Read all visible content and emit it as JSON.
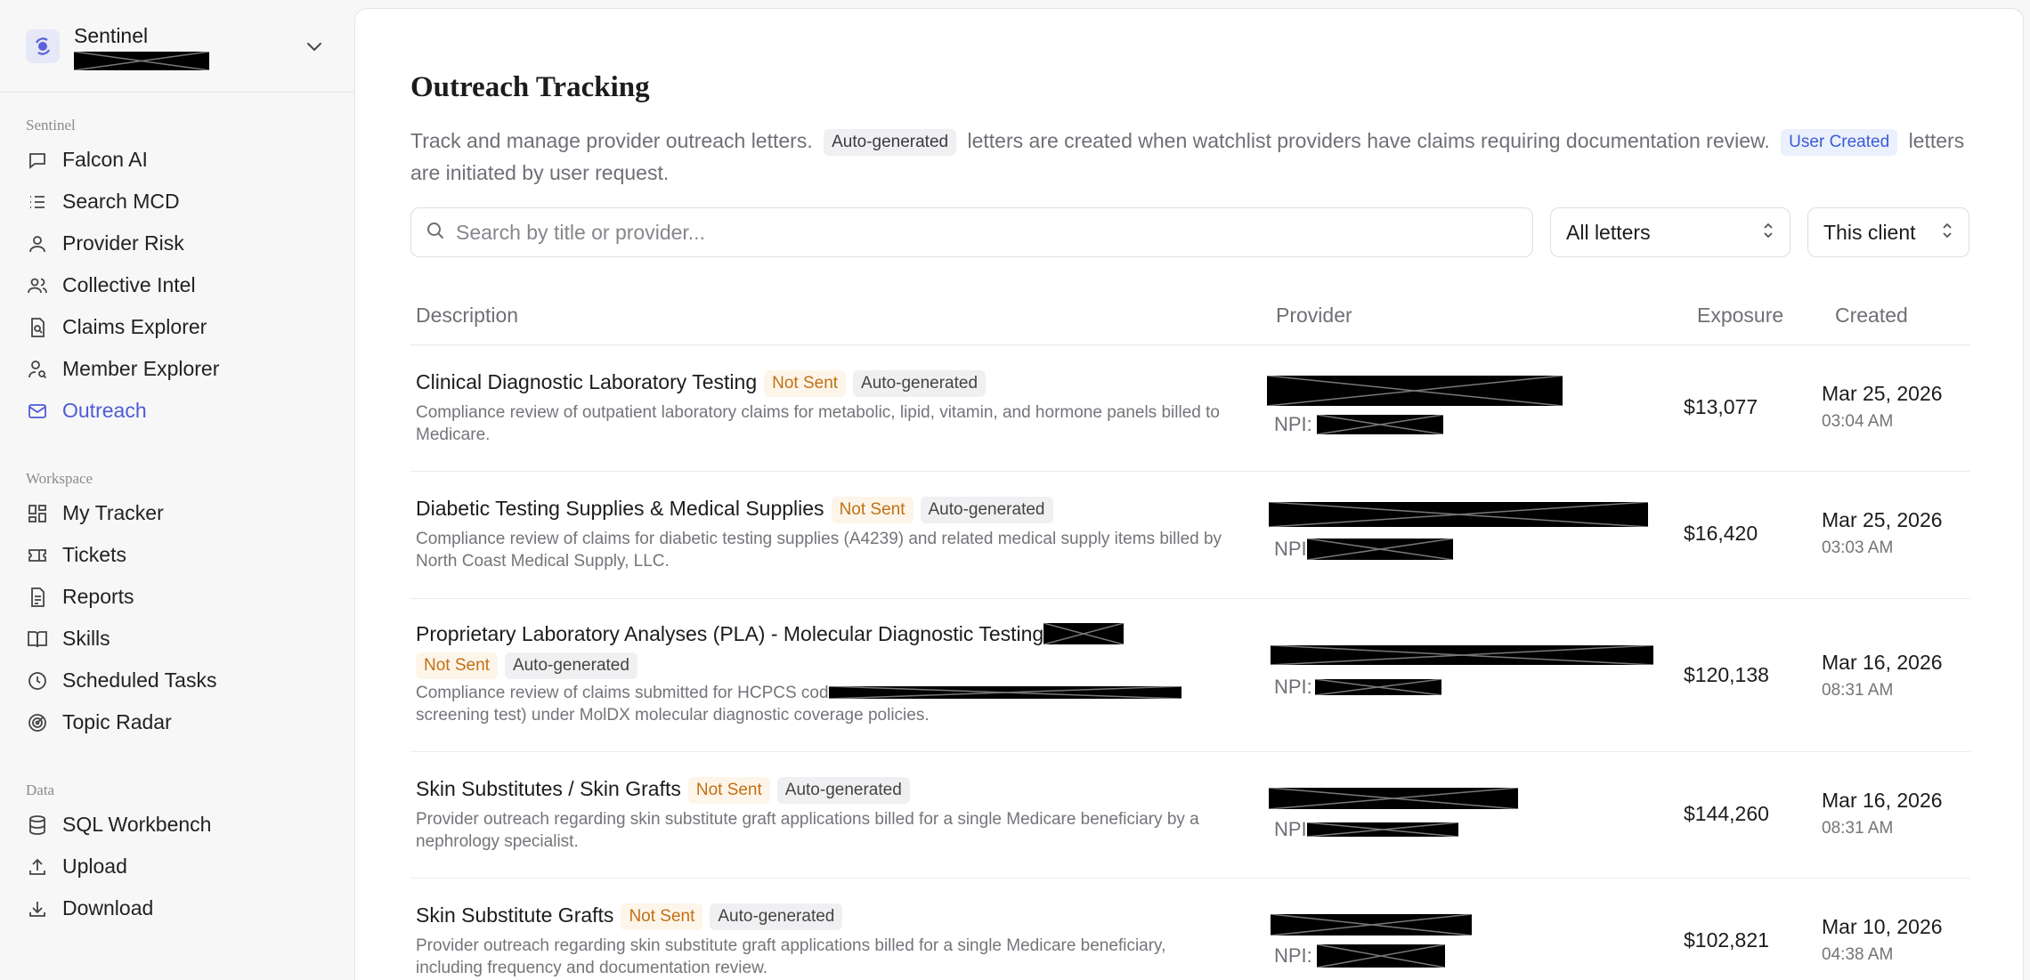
{
  "org": {
    "name": "Sentinel"
  },
  "nav": {
    "sections": [
      {
        "label": "Sentinel",
        "items": [
          {
            "label": "Falcon AI",
            "icon": "chat-icon"
          },
          {
            "label": "Search MCD",
            "icon": "list-icon"
          },
          {
            "label": "Provider Risk",
            "icon": "user-icon"
          },
          {
            "label": "Collective Intel",
            "icon": "users-icon"
          },
          {
            "label": "Claims Explorer",
            "icon": "document-search-icon"
          },
          {
            "label": "Member Explorer",
            "icon": "user-search-icon"
          },
          {
            "label": "Outreach",
            "icon": "mail-icon",
            "active": true
          }
        ]
      },
      {
        "label": "Workspace",
        "items": [
          {
            "label": "My Tracker",
            "icon": "dashboard-icon"
          },
          {
            "label": "Tickets",
            "icon": "ticket-icon"
          },
          {
            "label": "Reports",
            "icon": "report-icon"
          },
          {
            "label": "Skills",
            "icon": "book-icon"
          },
          {
            "label": "Scheduled Tasks",
            "icon": "clock-icon"
          },
          {
            "label": "Topic Radar",
            "icon": "radar-icon"
          }
        ]
      },
      {
        "label": "Data",
        "items": [
          {
            "label": "SQL Workbench",
            "icon": "database-icon"
          },
          {
            "label": "Upload",
            "icon": "upload-icon"
          },
          {
            "label": "Download",
            "icon": "download-icon"
          }
        ]
      }
    ]
  },
  "page": {
    "title": "Outreach Tracking",
    "intro_part1": "Track and manage provider outreach letters.",
    "chip_auto": "Auto-generated",
    "intro_part2": "letters are created when watchlist providers have claims requiring documentation review.",
    "chip_user": "User Created",
    "intro_part3": "letters are initiated by user request."
  },
  "filters": {
    "search_placeholder": "Search by title or provider...",
    "letters_value": "All letters",
    "scope_value": "This client"
  },
  "table": {
    "headers": {
      "description": "Description",
      "provider": "Provider",
      "exposure": "Exposure",
      "created": "Created"
    },
    "rows": [
      {
        "title": "Clinical Diagnostic Laboratory Testing",
        "status": "Not Sent",
        "source": "Auto-generated",
        "description": "Compliance review of outpatient laboratory claims for metabolic, lipid, vitamin, and hormone panels billed to Medicare.",
        "npi_label": "NPI:",
        "exposure": "$13,077",
        "date": "Mar 25, 2026",
        "time": "03:04 AM"
      },
      {
        "title": "Diabetic Testing Supplies & Medical Supplies",
        "status": "Not Sent",
        "source": "Auto-generated",
        "description": "Compliance review of claims for diabetic testing supplies (A4239) and related medical supply items billed by North Coast Medical Supply, LLC.",
        "npi_label": "NPI",
        "exposure": "$16,420",
        "date": "Mar 25, 2026",
        "time": "03:03 AM"
      },
      {
        "title": "Proprietary Laboratory Analyses (PLA) - Molecular Diagnostic Testing",
        "status": "Not Sent",
        "source": "Auto-generated",
        "description_part1": "Compliance review of claims submitted for HCPCS cod",
        "description_part2": "screening test) under MolDX molecular diagnostic coverage policies.",
        "npi_label": "NPI:",
        "exposure": "$120,138",
        "date": "Mar 16, 2026",
        "time": "08:31 AM"
      },
      {
        "title": "Skin Substitutes / Skin Grafts",
        "status": "Not Sent",
        "source": "Auto-generated",
        "description": "Provider outreach regarding skin substitute graft applications billed for a single Medicare beneficiary by a nephrology specialist.",
        "npi_label": "NPI",
        "exposure": "$144,260",
        "date": "Mar 16, 2026",
        "time": "08:31 AM"
      },
      {
        "title": "Skin Substitute Grafts",
        "status": "Not Sent",
        "source": "Auto-generated",
        "description": "Provider outreach regarding skin substitute graft applications billed for a single Medicare beneficiary, including frequency and documentation review.",
        "npi_label": "NPI:",
        "exposure": "$102,821",
        "date": "Mar 10, 2026",
        "time": "04:38 AM"
      }
    ]
  },
  "colors": {
    "accent": "#4f5bd5",
    "not_sent": "#c27015",
    "user_created": "#3a5bd6"
  }
}
